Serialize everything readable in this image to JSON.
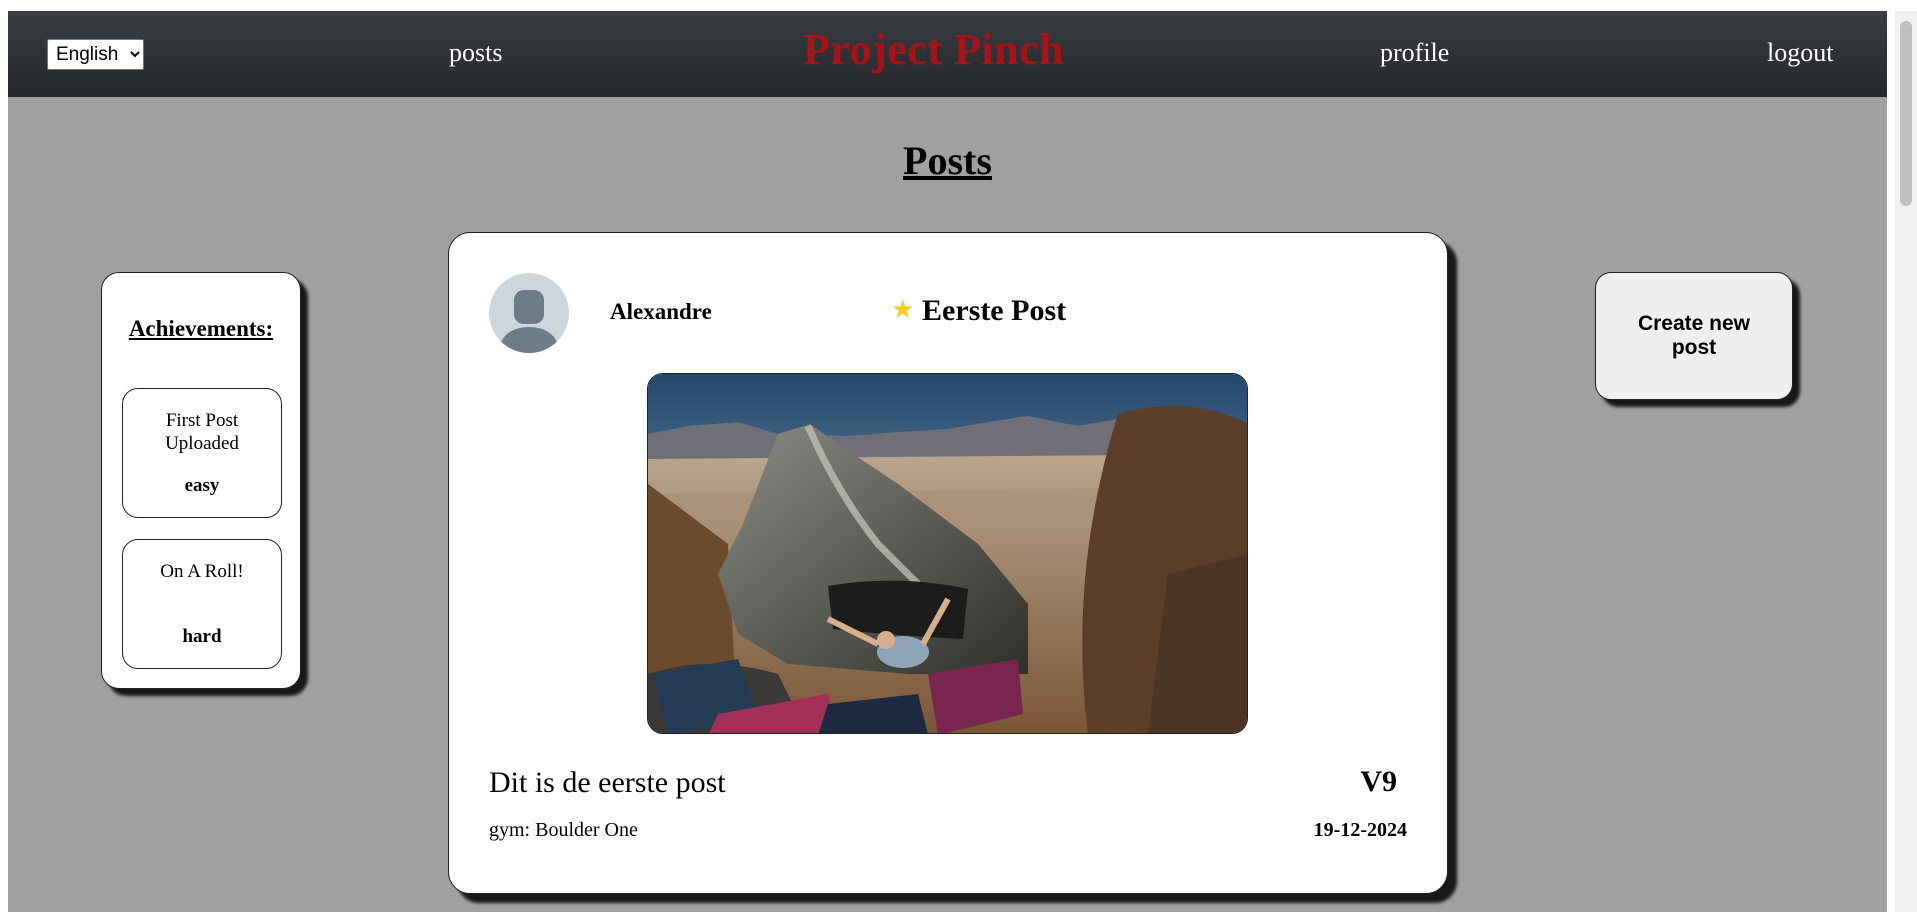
{
  "header": {
    "language_options": [
      "English"
    ],
    "language_selected": "English",
    "nav": {
      "posts": "posts",
      "brand": "Project Pinch",
      "profile": "profile",
      "logout": "logout"
    }
  },
  "main": {
    "title": "Posts"
  },
  "achievements": {
    "title": "Achievements:",
    "items": [
      {
        "name": "First Post Uploaded",
        "level": "easy"
      },
      {
        "name": "On A Roll!",
        "level": "hard"
      }
    ]
  },
  "create_post": {
    "label": "Create new post"
  },
  "post": {
    "author": "Alexandre",
    "starred": true,
    "title": "Eerste Post",
    "image_subject": "climber on a boulder in a mountain landscape",
    "caption": "Dit is de eerste post",
    "grade": "V9",
    "gym_label": "gym:",
    "gym": "Boulder One",
    "date": "19-12-2024"
  },
  "colors": {
    "brand": "#a51419",
    "page_background": "#a0a0a0",
    "nav_background": "#2b2e33",
    "star": "#f5cc2c"
  },
  "icons": {
    "avatar": "default-user-avatar-icon",
    "star": "star-icon"
  }
}
